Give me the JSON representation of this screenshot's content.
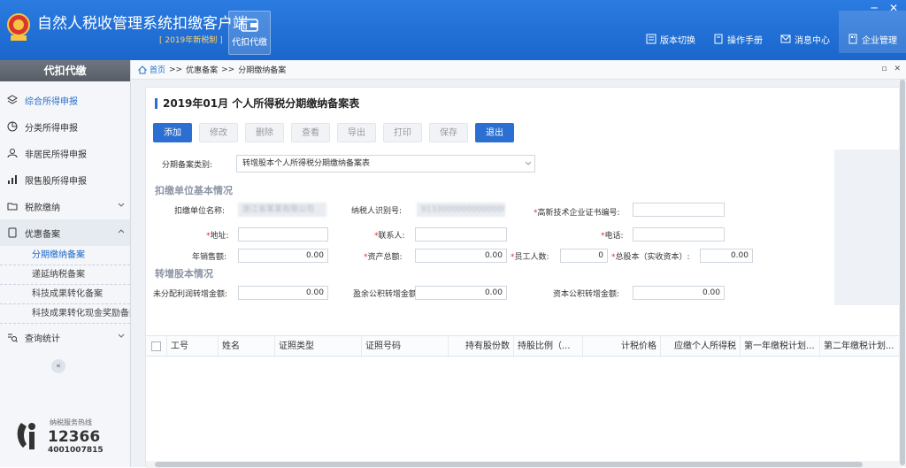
{
  "app": {
    "title": "自然人税收管理系统扣缴客户端",
    "subtitle": "[ 2019年新税制 ]",
    "module_label": "代扣代缴"
  },
  "window_controls": [
    "─",
    "✕"
  ],
  "top_menu": [
    {
      "label": "版本切换",
      "icon": "switch-icon"
    },
    {
      "label": "操作手册",
      "icon": "manual-icon"
    },
    {
      "label": "消息中心",
      "icon": "mail-icon"
    },
    {
      "label": "企业管理",
      "icon": "building-icon"
    }
  ],
  "sidebar": {
    "header": "代扣代缴",
    "items": [
      {
        "label": "综合所得申报",
        "icon": "layers-icon"
      },
      {
        "label": "分类所得申报",
        "icon": "pie-icon"
      },
      {
        "label": "非居民所得申报",
        "icon": "user-icon"
      },
      {
        "label": "限售股所得申报",
        "icon": "bar-icon"
      },
      {
        "label": "税款缴纳",
        "icon": "folder-icon"
      },
      {
        "label": "优惠备案",
        "icon": "doc-icon"
      }
    ],
    "sub_items": [
      "分期缴纳备案",
      "递延纳税备案",
      "科技成果转化备案",
      "科技成果转化现金奖励备案"
    ],
    "query_item": {
      "label": "查询统计",
      "icon": "search-list-icon"
    },
    "collapse": "«",
    "hotline": {
      "label": "纳税服务热线",
      "number": "12366",
      "sub": "4001007815"
    }
  },
  "breadcrumb": {
    "home": "首页",
    "sep": ">>",
    "level1": "优惠备案",
    "level2": "分期缴纳备案"
  },
  "breadcrumb_ctrls": [
    "▫",
    "✕"
  ],
  "panel": {
    "title": "2019年01月 个人所得税分期缴纳备案表",
    "toolbar": [
      "添加",
      "修改",
      "删除",
      "查看",
      "导出",
      "打印",
      "保存",
      "退出"
    ]
  },
  "form": {
    "category_label": "分期备案类别:",
    "category_value": "转增股本个人所得税分期缴纳备案表",
    "section1": "扣缴单位基本情况",
    "unit_name_label": "扣缴单位名称:",
    "unit_name_value": "浙江省某某有限公司",
    "taxpayer_id_label": "纳税人识别号:",
    "taxpayer_id_value": "913300000000000000",
    "hightech_label": "高新技术企业证书编号:",
    "address_label": "地址:",
    "contact_label": "联系人:",
    "phone_label": "电话:",
    "sales_label": "年销售额:",
    "sales_value": "0.00",
    "assets_label": "资产总额:",
    "assets_value": "0.00",
    "employees_label": "员工人数:",
    "employees_value": "0",
    "capital_label": "总股本（实收资本）:",
    "capital_value": "0.00",
    "section2": "转增股本情况",
    "undistributed_label": "未分配利润转增金额:",
    "undistributed_value": "0.00",
    "surplus_label": "盈余公积转增金额:",
    "surplus_value": "0.00",
    "capital_reserve_label": "资本公积转增金额:",
    "capital_reserve_value": "0.00"
  },
  "grid": {
    "columns": [
      "工号",
      "姓名",
      "证照类型",
      "证照号码",
      "持有股份数",
      "持股比例（...",
      "计税价格",
      "应缴个人所得税",
      "第一年缴税计划...",
      "第二年缴税计划..."
    ]
  }
}
